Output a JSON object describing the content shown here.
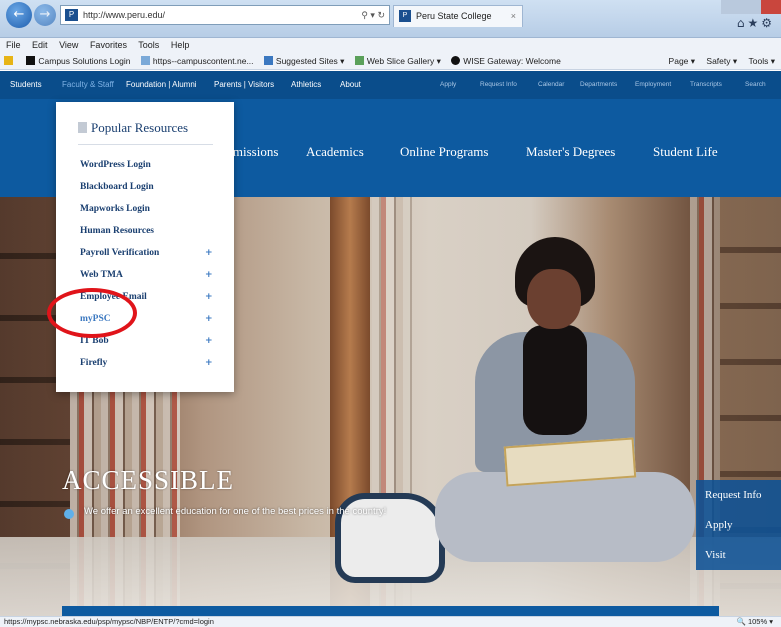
{
  "browser": {
    "url": "http://www.peru.edu/",
    "tab_title": "Peru State College",
    "menu": [
      "File",
      "Edit",
      "View",
      "Favorites",
      "Tools",
      "Help"
    ],
    "favorites": [
      "Campus Solutions Login",
      "https--campuscontent.ne...",
      "Suggested Sites ▾",
      "Web Slice Gallery ▾",
      "WISE Gateway: Welcome"
    ],
    "commands": [
      "Page ▾",
      "Safety ▾",
      "Tools ▾"
    ],
    "status_url": "https://mypsc.nebraska.edu/psp/mypsc/NBP/ENTP/?cmd=login",
    "zoom": "105%"
  },
  "topnav": {
    "left": [
      "Students",
      "Faculty & Staff",
      "Foundation | Alumni",
      "Parents | Visitors",
      "Athletics",
      "About"
    ],
    "right": [
      "Apply",
      "Request Info",
      "Calendar",
      "Departments",
      "Employment",
      "Transcripts",
      "Search"
    ]
  },
  "mainnav": [
    "Admissions",
    "Academics",
    "Online Programs",
    "Master's Degrees",
    "Student Life"
  ],
  "dropdown": {
    "heading": "Popular Resources",
    "items": [
      {
        "label": "WordPress Login",
        "arrow": ""
      },
      {
        "label": "Blackboard Login",
        "arrow": ""
      },
      {
        "label": "Mapworks Login",
        "arrow": ""
      },
      {
        "label": "Human Resources",
        "arrow": ""
      },
      {
        "label": "Payroll Verification",
        "arrow": "+"
      },
      {
        "label": "Web TMA",
        "arrow": "+"
      },
      {
        "label": "Employee Email",
        "arrow": "+"
      },
      {
        "label": "myPSC",
        "arrow": "+"
      },
      {
        "label": "IT Bob",
        "arrow": "+"
      },
      {
        "label": "Firefly",
        "arrow": "+"
      }
    ]
  },
  "hero": {
    "title": "ACCESSIBLE",
    "text": "We offer an excellent education for one of the best prices in the country!"
  },
  "side_cta": [
    "Request Info",
    "Apply",
    "Visit"
  ],
  "colors": {
    "brand_blue": "#0d5aa0",
    "highlight": "#e0141a"
  }
}
